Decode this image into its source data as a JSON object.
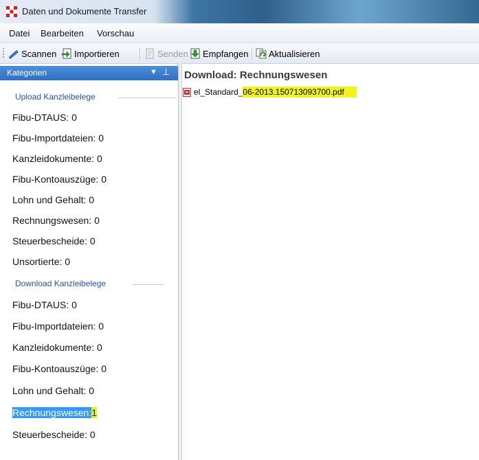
{
  "window": {
    "title": "Daten und Dokumente Transfer"
  },
  "menu": [
    "Datei",
    "Bearbeiten",
    "Vorschau"
  ],
  "toolbar": {
    "scan": "Scannen",
    "import": "Importieren",
    "send": "Senden",
    "receive": "Empfangen",
    "refresh": "Aktualisieren"
  },
  "sidebar": {
    "header": "Kategorien",
    "upload_group": "Upload Kanzleibelege",
    "upload_items": [
      "Fibu-DTAUS: 0",
      "Fibu-Importdateien: 0",
      "Kanzleidokumente: 0",
      "Fibu-Kontoauszüge: 0",
      "Lohn und Gehalt: 0",
      "Rechnungswesen: 0",
      "Steuerbescheide: 0",
      "Unsortierte: 0"
    ],
    "download_group": "Download Kanzleibelege",
    "download_items": [
      "Fibu-DTAUS: 0",
      "Fibu-Importdateien: 0",
      "Kanzleidokumente: 0",
      "Fibu-Kontoauszüge: 0",
      "Lohn und Gehalt: 0"
    ],
    "selected_item": {
      "label": "Rechnungswesen:",
      "count": "1"
    },
    "last_item": "Steuerbescheide: 0"
  },
  "main": {
    "title": "Download: Rechnungswesen",
    "file_prefix": "el_Standard_",
    "file_highlight": "06-2013.150713093700.pdf"
  }
}
